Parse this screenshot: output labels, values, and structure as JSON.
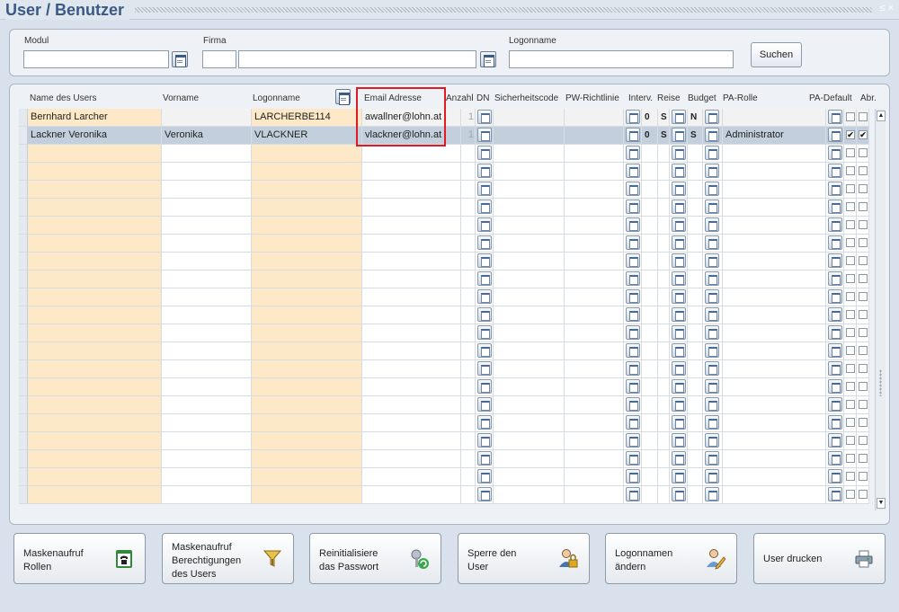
{
  "window": {
    "title": "User / Benutzer",
    "controls": "≤ ×"
  },
  "search": {
    "modul_label": "Modul",
    "firma_label": "Firma",
    "logon_label": "Logonname",
    "modul_value": "",
    "firma_code": "",
    "firma_value": "",
    "logon_value": "",
    "search_button": "Suchen"
  },
  "table": {
    "headers": {
      "name": "Name des Users",
      "vorname": "Vorname",
      "logonname": "Logonname",
      "email": "Email Adresse",
      "anzahl": "Anzahl",
      "dn": "DN",
      "sicherheit": "Sicherheitscode",
      "pw": "PW-Richtlinie",
      "interv": "Interv.",
      "reise": "Reise",
      "budget": "Budget",
      "parolle": "PA-Rolle",
      "padefault": "PA-Default",
      "abr": "Abr."
    },
    "rows": [
      {
        "name": "Bernhard  Larcher",
        "vorname": "",
        "logon": "LARCHERBE114",
        "email": "awallner@lohn.at",
        "anzahl": "1",
        "interv": "0",
        "s": "S",
        "reise": "N",
        "rolle": "",
        "chk1": "",
        "chk2": ""
      },
      {
        "name": "Lackner Veronika",
        "vorname": "Veronika",
        "logon": "VLACKNER",
        "email": "vlackner@lohn.at",
        "anzahl": "1",
        "interv": "0",
        "s": "S",
        "reise": "S",
        "rolle": "Administrator",
        "chk1": "✔",
        "chk2": "✔"
      }
    ]
  },
  "buttons": [
    {
      "label": "Maskenaufruf\nRollen",
      "icon": "phone-icon"
    },
    {
      "label": "Maskenaufruf\nBerechtigungen\ndes Users",
      "icon": "funnel-icon"
    },
    {
      "label": "Reinitialisiere\ndas Passwort",
      "icon": "key-refresh-icon"
    },
    {
      "label": "Sperre den\nUser",
      "icon": "user-lock-icon"
    },
    {
      "label": "Logonnamen\nändern",
      "icon": "user-edit-icon"
    },
    {
      "label": "User drucken",
      "icon": "printer-icon"
    }
  ]
}
